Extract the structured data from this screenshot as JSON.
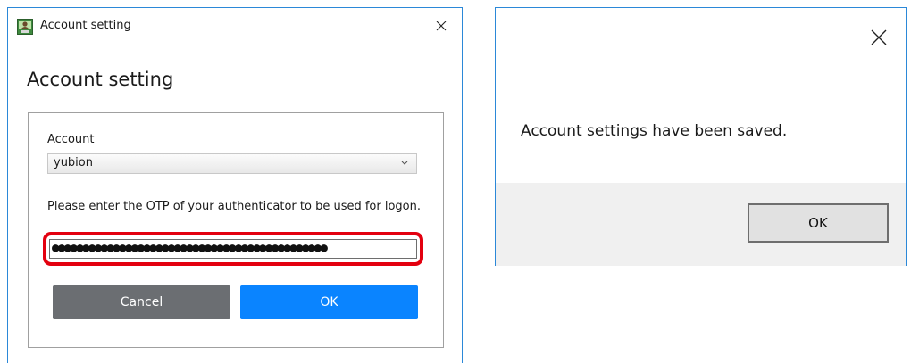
{
  "account_dialog": {
    "window_title": "Account setting",
    "heading": "Account setting",
    "account_label": "Account",
    "account_selected": "yubion",
    "otp_label": "Please enter the OTP of your authenticator to be used for logon.",
    "otp_value": "●●●●●●●●●●●●●●●●●●●●●●●●●●●●●●●●●●●●●●●●●●●●●",
    "cancel_label": "Cancel",
    "ok_label": "OK",
    "icons": {
      "app": "app-icon",
      "close": "close-icon",
      "dropdown": "chevron-down-icon"
    },
    "colors": {
      "highlight": "#e3000f",
      "cancel_button": "#6b6e72",
      "ok_button": "#0a84ff"
    }
  },
  "confirm_dialog": {
    "message": "Account settings have been saved.",
    "ok_label": "OK",
    "icons": {
      "close": "close-icon"
    }
  }
}
